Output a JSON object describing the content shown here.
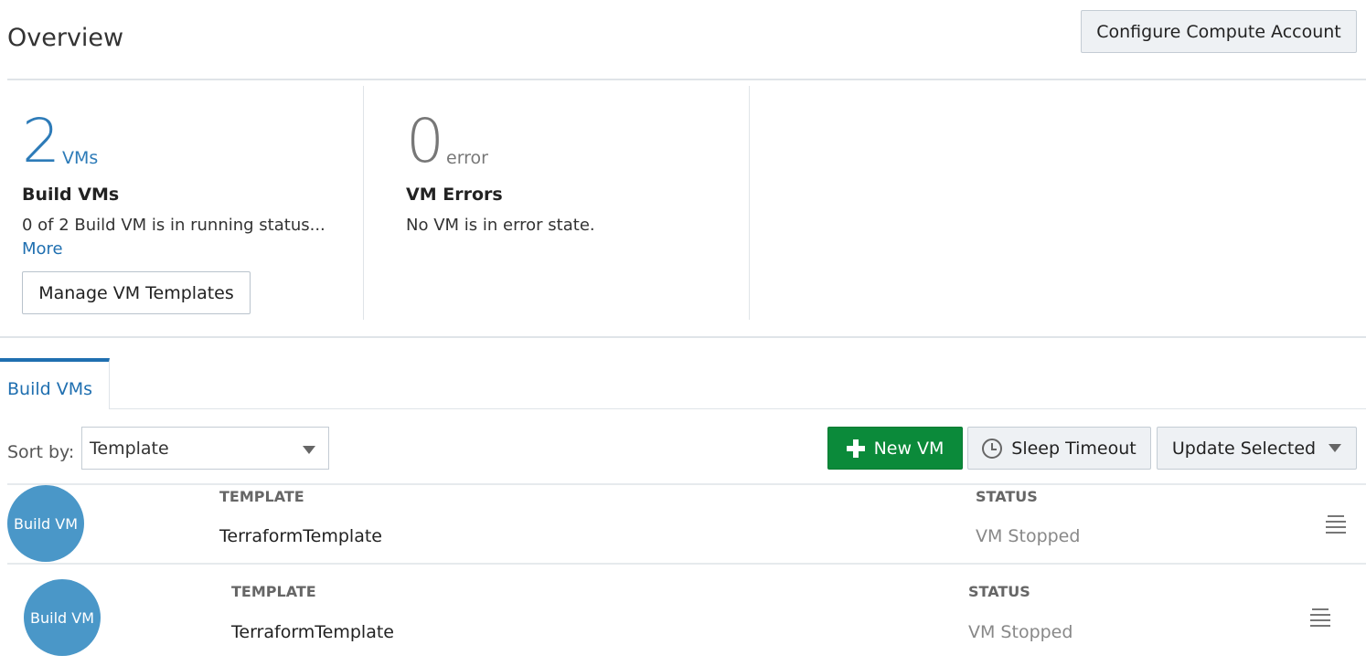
{
  "header": {
    "title": "Overview",
    "configure_label": "Configure Compute Account"
  },
  "cards": {
    "build_vms": {
      "count": "2",
      "unit": "VMs",
      "heading": "Build VMs",
      "description": "0 of 2 Build VM is in running status...",
      "more_label": "More",
      "manage_label": "Manage VM Templates"
    },
    "vm_errors": {
      "count": "0",
      "unit": "error",
      "heading": "VM Errors",
      "description": "No VM is in error state."
    }
  },
  "tabs": [
    {
      "label": "Build VMs",
      "active": true
    }
  ],
  "toolbar": {
    "sort_label": "Sort by:",
    "sort_value": "Template",
    "new_vm_label": "New VM",
    "sleep_timeout_label": "Sleep Timeout",
    "update_selected_label": "Update Selected"
  },
  "columns": {
    "template": "TEMPLATE",
    "status": "STATUS"
  },
  "vms": [
    {
      "avatar": "Build VM",
      "template": "TerraformTemplate",
      "status": "VM Stopped"
    },
    {
      "avatar": "Build VM",
      "template": "TerraformTemplate",
      "status": "VM Stopped"
    }
  ],
  "colors": {
    "accent": "#1f6fb0",
    "primary_button": "#0b8a3a",
    "avatar": "#4a97c8"
  }
}
